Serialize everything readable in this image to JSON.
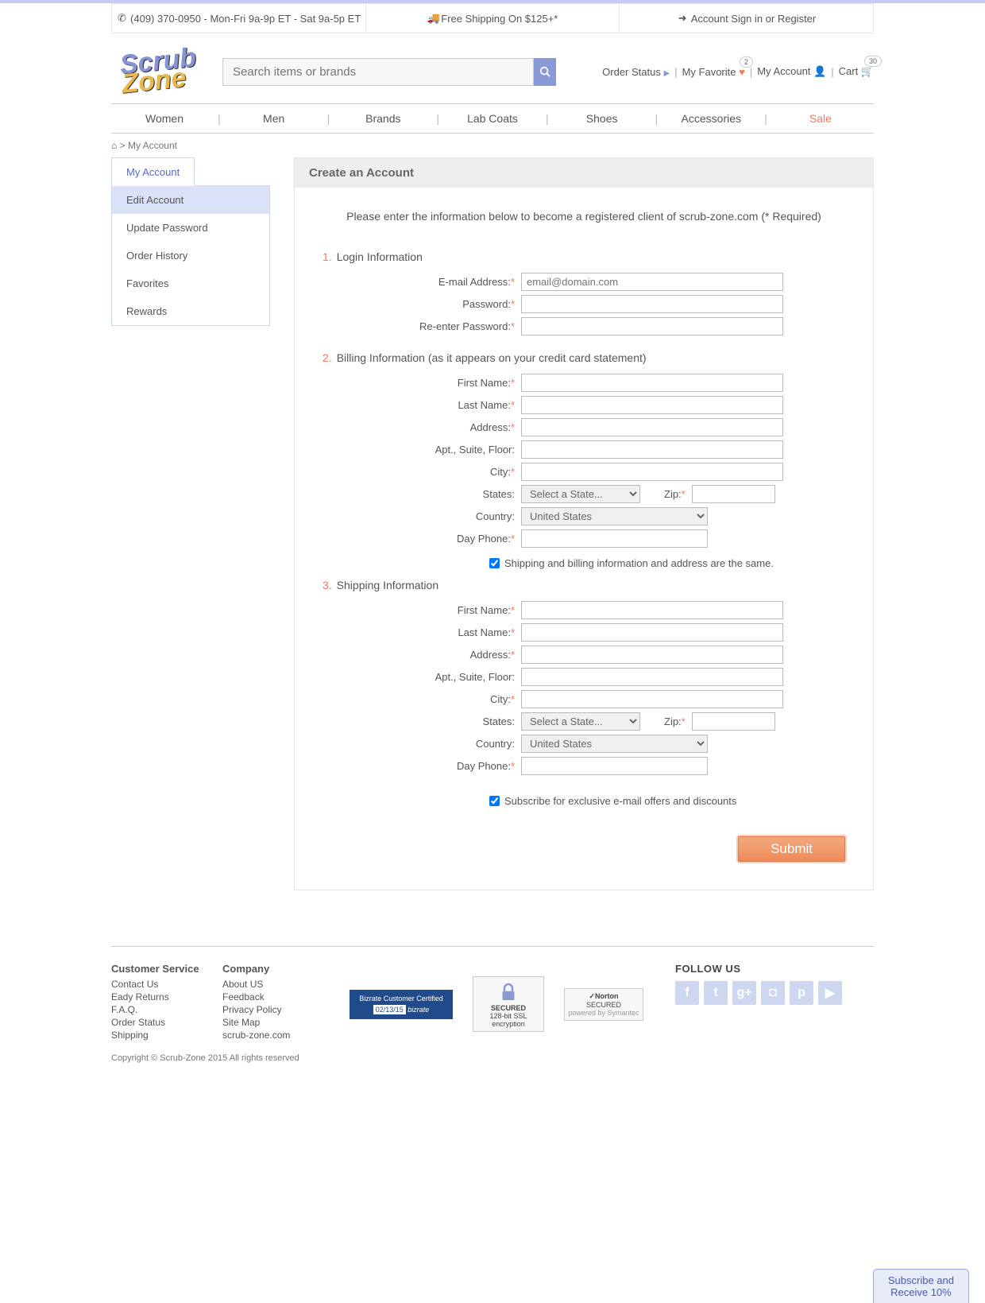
{
  "topbar": {
    "phone": "(409) 370-0950 - Mon-Fri 9a-9p ET - Sat 9a-5p ET",
    "shipping": "Free Shipping On $125+*",
    "account": "Account Sign in or Register"
  },
  "logo": {
    "line1": "Scrub",
    "line2": "Zone"
  },
  "search": {
    "placeholder": "Search items or brands"
  },
  "header_links": {
    "order_status": "Order Status",
    "favorite": "My Favorite",
    "fav_count": "2",
    "my_account": "My Account",
    "cart": "Cart",
    "cart_count": "30"
  },
  "nav": [
    "Women",
    "Men",
    "Brands",
    "Lab Coats",
    "Shoes",
    "Accessories",
    "Sale"
  ],
  "breadcrumb": {
    "sep": ">",
    "current": "My Account"
  },
  "sidebar": {
    "tab": "My Account",
    "items": [
      "Edit Account",
      "Update Password",
      "Order History",
      "Favorites",
      "Rewards"
    ]
  },
  "page": {
    "title": "Create an Account",
    "intro": "Please enter the information below to become a registered client of scrub-zone.com (* Required)",
    "sec1": {
      "num": "1.",
      "title": "Login Information",
      "email": "E-mail Address:",
      "email_ph": "email@domain.com",
      "pass": "Password:",
      "repass": "Re-enter Password:"
    },
    "sec2": {
      "num": "2.",
      "title": "Billing Information (as it appears on your credit card statement)",
      "fname": "First Name:",
      "lname": "Last Name:",
      "addr": "Address:",
      "apt": "Apt., Suite, Floor:",
      "city": "City:",
      "states": "States:",
      "state_ph": "Select a State...",
      "zip": "Zip:",
      "country": "Country:",
      "country_ph": "United States",
      "phone": "Day Phone:",
      "same": "Shipping and billing information and address are the same."
    },
    "sec3": {
      "num": "3.",
      "title": "Shipping Information",
      "subscribe": "Subscribe for exclusive e-mail offers and discounts"
    },
    "submit": "Submit"
  },
  "footer": {
    "col1": {
      "h": "Customer Service",
      "items": [
        "Contact Us",
        "Eady Returns",
        "F.A.Q.",
        "Order Status",
        "Shipping"
      ]
    },
    "col2": {
      "h": "Company",
      "items": [
        "About US",
        "Feedback",
        "Privacy Policy",
        "Site Map",
        "scrub-zone.com"
      ]
    },
    "biz": {
      "line1": "Bizrate Customer Certified",
      "date": "02/13/15",
      "brand": "bizrate"
    },
    "ssl": {
      "t": "SECURED",
      "s": "128-bit SSL encryption"
    },
    "norton": {
      "t": "Norton",
      "s": "SECURED",
      "p": "powered by Symantec"
    },
    "follow": "FOLLOW US",
    "copy": "Copyright © Scrub-Zone 2015 All rights reserved"
  },
  "subscribe_widget": {
    "line1": "Subscribe and",
    "line2": "Receive 10%"
  }
}
